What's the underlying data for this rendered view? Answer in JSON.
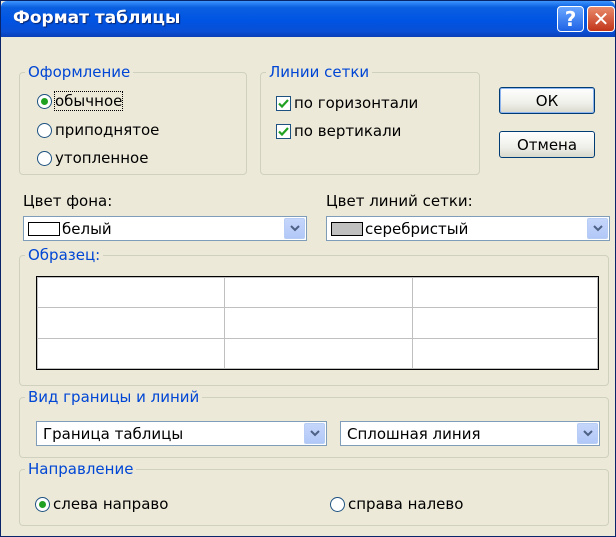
{
  "window": {
    "title": "Формат таблицы",
    "help_label": "?",
    "close_label": "✕"
  },
  "design": {
    "legend": "Оформление",
    "options": [
      {
        "label": "обычное",
        "selected": true
      },
      {
        "label": "приподнятое",
        "selected": false
      },
      {
        "label": "утопленное",
        "selected": false
      }
    ]
  },
  "gridlines": {
    "legend": "Линии сетки",
    "horizontal": {
      "label": "по горизонтали",
      "checked": true
    },
    "vertical": {
      "label": "по вертикали",
      "checked": true
    }
  },
  "buttons": {
    "ok": "ОК",
    "cancel": "Отмена"
  },
  "background_color": {
    "label": "Цвет фона:",
    "value": "белый",
    "swatch": "#ffffff"
  },
  "gridline_color": {
    "label": "Цвет линий сетки:",
    "value": "серебристый",
    "swatch": "#c0c0c0"
  },
  "sample": {
    "legend": "Образец:",
    "rows": 3,
    "cols": 3
  },
  "border_style": {
    "legend": "Вид границы и линий",
    "element": "Граница таблицы",
    "line_style": "Сплошная линия"
  },
  "direction": {
    "legend": "Направление",
    "options": [
      {
        "label": "слева направо",
        "selected": true
      },
      {
        "label": "справа налево",
        "selected": false
      }
    ]
  },
  "colors": {
    "title_bar": "#0054e3",
    "group_legend": "#0046d5",
    "dialog_bg": "#ece9d8",
    "radio_dot": "#21a121",
    "check_mark": "#21a121"
  }
}
